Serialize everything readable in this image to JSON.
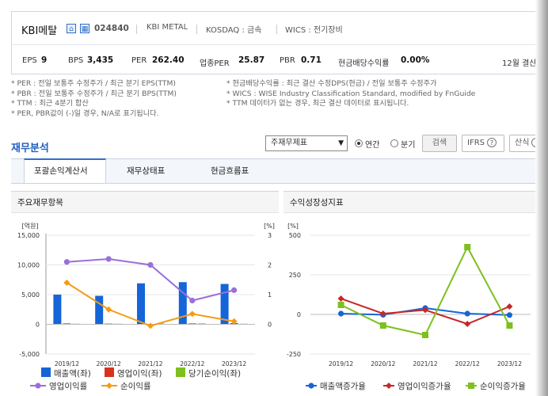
{
  "company": {
    "name": "KBI메탈",
    "code": "024840",
    "english_name": "KBI METAL",
    "market": "KOSDAQ : 금속",
    "wics": "WICS : 전기장비",
    "icons": [
      "home-icon",
      "building-icon"
    ]
  },
  "metrics": [
    {
      "label": "EPS",
      "value": "9"
    },
    {
      "label": "BPS",
      "value": "3,435"
    },
    {
      "label": "PER",
      "value": "262.40"
    },
    {
      "label": "업종PER",
      "value": "25.87"
    },
    {
      "label": "PBR",
      "value": "0.71"
    },
    {
      "label": "현금배당수익률",
      "value": "0.00%"
    }
  ],
  "settlement": "12월 결산",
  "notes_left": [
    "* PER : 전일 보통주 수정주가 / 최근 분기 EPS(TTM)",
    "* PBR : 전일 보통주 수정주가 / 최근 분기 BPS(TTM)",
    "* TTM : 최근 4분기 합산",
    "* PER, PBR값이 (-)일 경우, N/A로 표기됩니다."
  ],
  "notes_right": [
    "* 현금배당수익률 : 최근 결산 수정DPS(현금) / 전일 보통주 수정주가",
    "* WICS : WISE Industry Classification Standard, modified by FnGuide",
    "* TTM 데이터가 없는 경우, 최근 결산 데이터로 표시됩니다."
  ],
  "section_title": "재무분석",
  "controls": {
    "select_value": "주재무제표",
    "radio_annual": "연간",
    "radio_quarter": "분기",
    "search": "검색",
    "ifrs": "IFRS",
    "formula": "산식"
  },
  "tabs": [
    "포괄손익계산서",
    "재무상태표",
    "현금흐름표"
  ],
  "panels": {
    "left_title": "주요재무항목",
    "right_title": "수익성장성지표"
  },
  "chart_data": [
    {
      "type": "bar",
      "title": "주요재무항목",
      "categories": [
        "2019/12",
        "2020/12",
        "2021/12",
        "2022/12",
        "2023/12"
      ],
      "y_left_label": "[억원]",
      "y_right_label": "[%]",
      "y_left_ticks": [
        "15,000",
        "10,000",
        "5,000",
        "0",
        "-5,000"
      ],
      "y_right_ticks": [
        "3",
        "2",
        "1",
        "0"
      ],
      "ylim_left": [
        -5000,
        15000
      ],
      "ylim_right": [
        -1,
        3
      ],
      "series": [
        {
          "name": "매출액(좌)",
          "kind": "bar",
          "axis": "left",
          "color": "#1565d8",
          "values": [
            5000,
            4800,
            6900,
            7100,
            6800
          ]
        },
        {
          "name": "영업이익(좌)",
          "kind": "bar",
          "axis": "left",
          "color": "#d8321f",
          "values": [
            150,
            120,
            -100,
            150,
            200
          ]
        },
        {
          "name": "당기순이익(좌)",
          "kind": "bar",
          "axis": "left",
          "color": "#7dc01f",
          "values": [
            100,
            100,
            150,
            150,
            100
          ]
        },
        {
          "name": "영업이익률",
          "kind": "line",
          "axis": "right",
          "color": "#9b6fd8",
          "values": [
            2.1,
            2.2,
            2.0,
            0.8,
            1.15
          ]
        },
        {
          "name": "순이익률",
          "kind": "line",
          "axis": "right",
          "color": "#f39c12",
          "values": [
            1.4,
            0.5,
            -0.05,
            0.35,
            0.1
          ]
        }
      ]
    },
    {
      "type": "line",
      "title": "수익성장성지표",
      "categories": [
        "2019/12",
        "2020/12",
        "2021/12",
        "2022/12",
        "2023/12"
      ],
      "y_label": "[%]",
      "y_ticks": [
        "500",
        "250",
        "0",
        "-250"
      ],
      "ylim": [
        -250,
        500
      ],
      "series": [
        {
          "name": "매출액증가율",
          "color": "#1565d8",
          "marker": "circle",
          "values": [
            5,
            -2,
            40,
            5,
            -4
          ]
        },
        {
          "name": "영업이익증가율",
          "color": "#c62828",
          "marker": "diamond",
          "values": [
            100,
            5,
            28,
            -60,
            50
          ]
        },
        {
          "name": "순이익증가율",
          "color": "#7dc01f",
          "marker": "square",
          "values": [
            60,
            -70,
            -130,
            425,
            -70
          ]
        }
      ]
    }
  ]
}
